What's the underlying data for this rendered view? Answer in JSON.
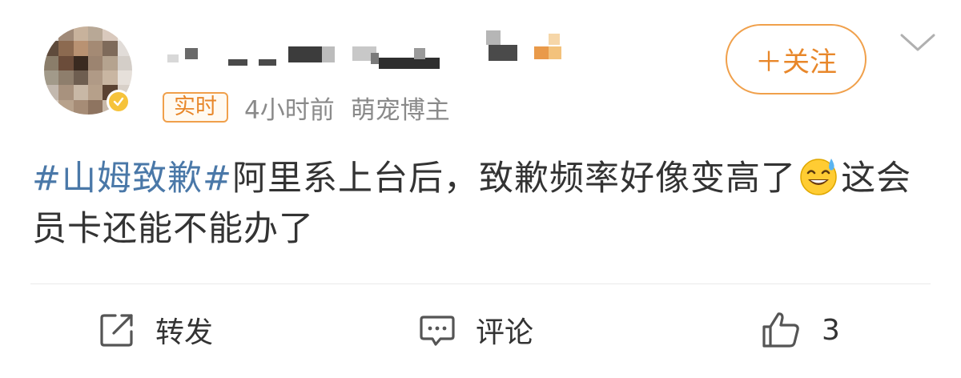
{
  "post": {
    "author": {
      "username_obscured": true,
      "avatar_obscured": true,
      "verified": true
    },
    "tag_realtime": "实时",
    "time": "4小时前",
    "category": "萌宠博主",
    "follow_label": "＋关注",
    "content": {
      "hashtag": "#山姆致歉#",
      "text_1": "阿里系上台后，致歉频率好像变高了",
      "emoji": "sweat-smile-emoji",
      "text_2": "这会员卡还能不能办了"
    }
  },
  "actions": {
    "repost_label": "转发",
    "comment_label": "评论",
    "like_count": "3"
  },
  "colors": {
    "accent_orange": "#e8872a",
    "hashtag_blue": "#4a78a8",
    "text_gray": "#8a8a8a"
  }
}
